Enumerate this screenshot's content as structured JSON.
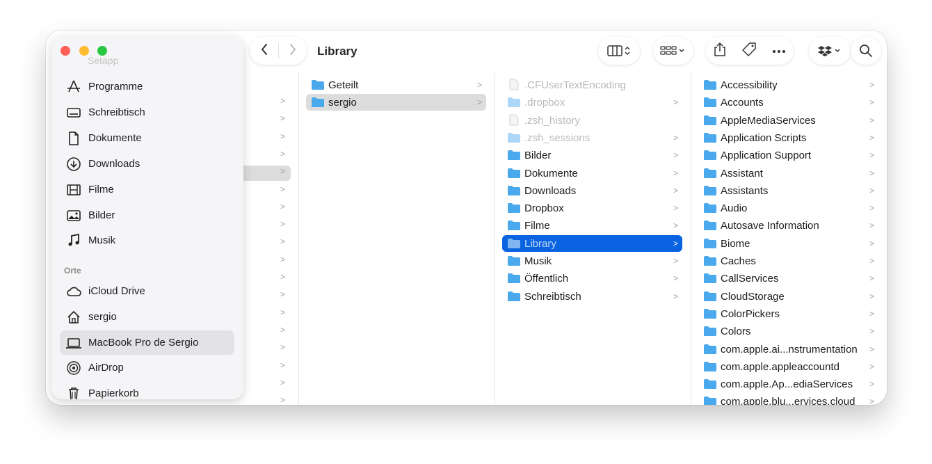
{
  "window": {
    "title": "Library",
    "traffic_lights": {
      "close": "#ff5f57",
      "minimize": "#febc2e",
      "zoom": "#28c840"
    }
  },
  "toolbar": {
    "back_icon": "chevron-left",
    "forward_icon": "chevron-right",
    "view_icon": "columns-view",
    "group_icon": "group-grid",
    "share_icon": "share",
    "tag_icon": "tag",
    "more_icon": "ellipsis",
    "dropbox_icon": "dropbox",
    "search_icon": "magnifier"
  },
  "sidebar": {
    "partial_top": "Setapp",
    "favorites": [
      {
        "label": "Programme",
        "icon": "apps-icon"
      },
      {
        "label": "Schreibtisch",
        "icon": "desktop-icon"
      },
      {
        "label": "Dokumente",
        "icon": "document-icon"
      },
      {
        "label": "Downloads",
        "icon": "download-icon"
      },
      {
        "label": "Filme",
        "icon": "film-icon"
      },
      {
        "label": "Bilder",
        "icon": "photo-icon"
      },
      {
        "label": "Musik",
        "icon": "music-icon"
      }
    ],
    "places_header": "Orte",
    "places": [
      {
        "label": "iCloud Drive",
        "icon": "cloud-icon"
      },
      {
        "label": "sergio",
        "icon": "home-icon"
      },
      {
        "label": "MacBook Pro de Sergio",
        "icon": "laptop-icon",
        "selected": true
      },
      {
        "label": "AirDrop",
        "icon": "airdrop-icon"
      },
      {
        "label": "Papierkorb",
        "icon": "trash-icon"
      }
    ]
  },
  "column1": [
    {
      "label": "Geteilt",
      "chevron": ">"
    },
    {
      "label": "sergio",
      "chevron": ">",
      "selected": true
    }
  ],
  "column2": [
    {
      "label": ".CFUserTextEncoding",
      "type": "file",
      "hidden": true
    },
    {
      "label": ".dropbox",
      "type": "folder",
      "hidden": true,
      "chevron": ">"
    },
    {
      "label": ".zsh_history",
      "type": "file",
      "hidden": true
    },
    {
      "label": ".zsh_sessions",
      "type": "folder",
      "hidden": true,
      "chevron": ">"
    },
    {
      "label": "Bilder",
      "type": "folder",
      "chevron": ">"
    },
    {
      "label": "Dokumente",
      "type": "folder",
      "chevron": ">"
    },
    {
      "label": "Downloads",
      "type": "folder",
      "chevron": ">"
    },
    {
      "label": "Dropbox",
      "type": "folder",
      "chevron": ">"
    },
    {
      "label": "Filme",
      "type": "folder",
      "chevron": ">"
    },
    {
      "label": "Library",
      "type": "folder",
      "chevron": ">",
      "selected": true
    },
    {
      "label": "Musik",
      "type": "folder",
      "chevron": ">"
    },
    {
      "label": "Öffentlich",
      "type": "folder",
      "chevron": ">"
    },
    {
      "label": "Schreibtisch",
      "type": "folder",
      "chevron": ">"
    }
  ],
  "column3": [
    {
      "label": "Accessibility",
      "chevron": ">"
    },
    {
      "label": "Accounts",
      "chevron": ">"
    },
    {
      "label": "AppleMediaServices",
      "chevron": ">"
    },
    {
      "label": "Application Scripts",
      "chevron": ">"
    },
    {
      "label": "Application Support",
      "chevron": ">"
    },
    {
      "label": "Assistant",
      "chevron": ">"
    },
    {
      "label": "Assistants",
      "chevron": ">"
    },
    {
      "label": "Audio",
      "chevron": ">"
    },
    {
      "label": "Autosave Information",
      "chevron": ">"
    },
    {
      "label": "Biome",
      "chevron": ">"
    },
    {
      "label": "Caches",
      "chevron": ">"
    },
    {
      "label": "CallServices",
      "chevron": ">"
    },
    {
      "label": "CloudStorage",
      "chevron": ">"
    },
    {
      "label": "ColorPickers",
      "chevron": ">"
    },
    {
      "label": "Colors",
      "chevron": ">"
    },
    {
      "label": "com.apple.ai...nstrumentation",
      "chevron": ">"
    },
    {
      "label": "com.apple.appleaccountd",
      "chevron": ">"
    },
    {
      "label": "com.apple.Ap...ediaServices",
      "chevron": ">"
    },
    {
      "label": "com.apple.blu...ervices.cloud",
      "chevron": ">"
    }
  ],
  "colors": {
    "selection_blue": "#0a63e0",
    "selection_gray": "#dcdcdc",
    "folder_blue": "#4aa8ec"
  }
}
